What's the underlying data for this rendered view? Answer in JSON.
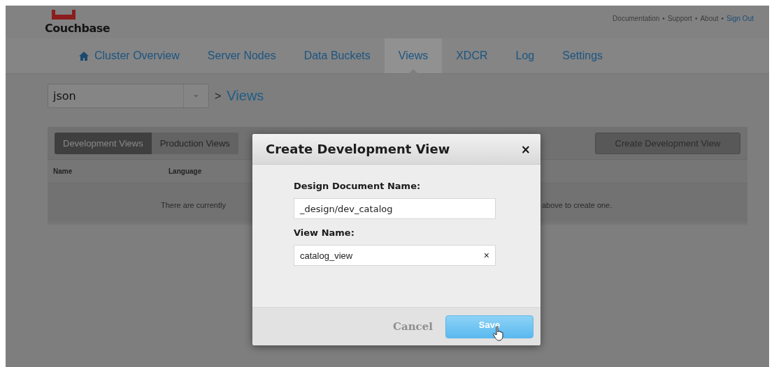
{
  "header": {
    "logo_text": "Couchbase",
    "links": [
      {
        "label": "Documentation",
        "kind": "plain"
      },
      {
        "label": "Support",
        "kind": "plain"
      },
      {
        "label": "About",
        "kind": "plain"
      },
      {
        "label": "Sign Out",
        "kind": "accent"
      }
    ],
    "separator": "•"
  },
  "nav": [
    {
      "label": "Cluster Overview",
      "selected": false,
      "home": true
    },
    {
      "label": "Server Nodes",
      "selected": false,
      "home": false
    },
    {
      "label": "Data Buckets",
      "selected": false,
      "home": false
    },
    {
      "label": "Views",
      "selected": true,
      "home": false
    },
    {
      "label": "XDCR",
      "selected": false,
      "home": false
    },
    {
      "label": "Log",
      "selected": false,
      "home": false
    },
    {
      "label": "Settings",
      "selected": false,
      "home": false
    }
  ],
  "bucket_select": {
    "value": "json"
  },
  "breadcrumb": {
    "separator": ">",
    "current": "Views"
  },
  "views_panel": {
    "tabs": [
      {
        "label": "Development Views",
        "selected": true
      },
      {
        "label": "Production Views",
        "selected": false
      }
    ],
    "create_button": "Create Development View",
    "columns": [
      "Name",
      "Language"
    ],
    "empty_message_parts": [
      "There are currently",
      "above to create one."
    ]
  },
  "dialog": {
    "title": "Create Development View",
    "close": "×",
    "fields": [
      {
        "label": "Design Document Name:",
        "value": "_design/dev_catalog"
      },
      {
        "label": "View Name:",
        "value": "catalog_view",
        "clear": "×"
      }
    ],
    "cancel": "Cancel",
    "save": "Save"
  }
}
